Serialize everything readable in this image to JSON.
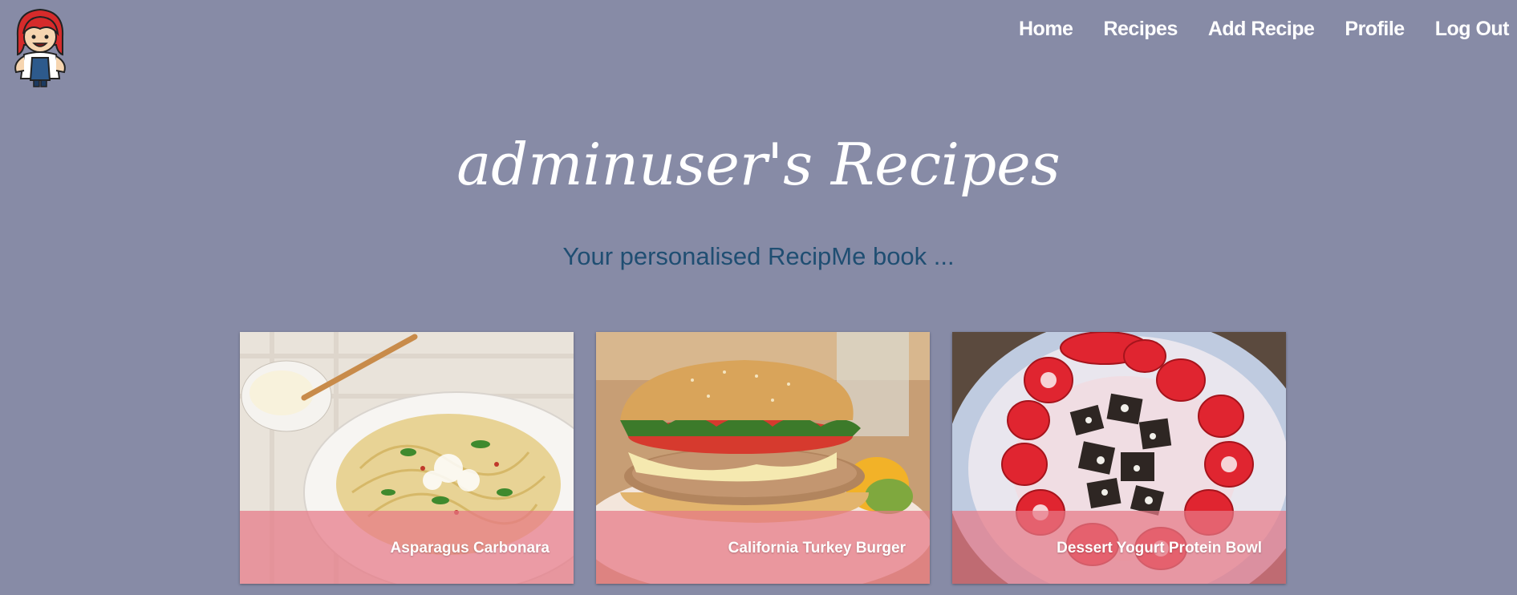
{
  "header": {
    "logo_icon": "chef-girl-icon",
    "nav": [
      "Home",
      "Recipes",
      "Add Recipe",
      "Profile",
      "Log Out"
    ]
  },
  "main": {
    "title": "adminuser's Recipes",
    "subtitle": "Your personalised RecipMe book ..."
  },
  "recipes": [
    {
      "name": "Asparagus Carbonara"
    },
    {
      "name": "California Turkey Burger"
    },
    {
      "name": "Dessert Yogurt Protein Bowl"
    }
  ],
  "colors": {
    "background": "#878BA6",
    "subtitle": "#1F4E72",
    "caption_bar": "#E67887"
  }
}
